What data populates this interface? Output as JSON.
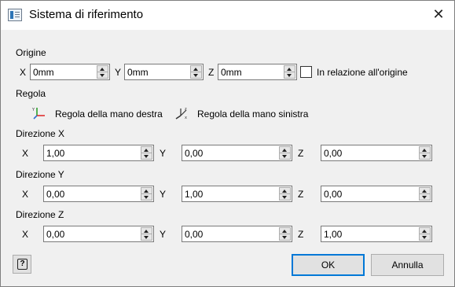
{
  "window": {
    "title": "Sistema di riferimento",
    "close_glyph": "✕"
  },
  "origin": {
    "section_label": "Origine",
    "x_label": "X",
    "x_value": "0mm",
    "y_label": "Y",
    "y_value": "0mm",
    "z_label": "Z",
    "z_value": "0mm",
    "relative_label": "In relazione all'origine",
    "relative_checked": false
  },
  "rule": {
    "section_label": "Regola",
    "right_hand_label": "Regola della mano destra",
    "left_hand_label": "Regola della mano sinistra",
    "right_hand_icon": "right-hand-axes-icon",
    "left_hand_icon": "left-hand-axes-icon"
  },
  "direction_x": {
    "section_label": "Direzione X",
    "x_label": "X",
    "x_value": "1,00",
    "y_label": "Y",
    "y_value": "0,00",
    "z_label": "Z",
    "z_value": "0,00"
  },
  "direction_y": {
    "section_label": "Direzione Y",
    "x_label": "X",
    "x_value": "0,00",
    "y_label": "Y",
    "y_value": "1,00",
    "z_label": "Z",
    "z_value": "0,00"
  },
  "direction_z": {
    "section_label": "Direzione Z",
    "x_label": "X",
    "x_value": "0,00",
    "y_label": "Y",
    "y_value": "0,00",
    "z_label": "Z",
    "z_value": "1,00"
  },
  "buttons": {
    "ok_label": "OK",
    "cancel_label": "Annulla",
    "help_glyph": "?"
  },
  "colors": {
    "ok_border": "#0078d7",
    "axis_x": "#e03030",
    "axis_y": "#2aa02a",
    "axis_z": "#2e6fd0"
  }
}
